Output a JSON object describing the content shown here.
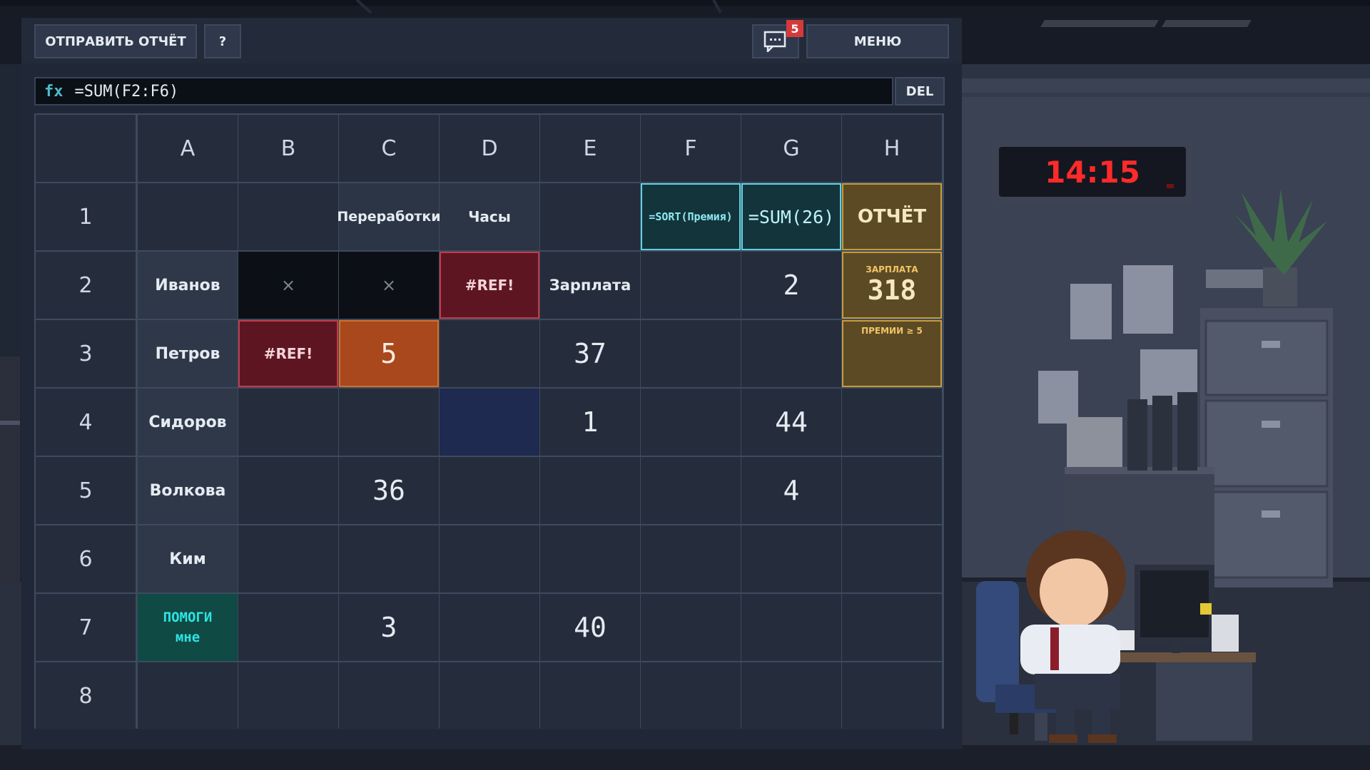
{
  "toolbar": {
    "send_report_label": "ОТПРАВИТЬ ОТЧЁТ",
    "help_label": "?",
    "messages_icon": "chat-icon",
    "messages_count": "5",
    "menu_label": "МЕНЮ"
  },
  "formula_bar": {
    "fx_label": "fx",
    "formula": "=SUM(F2:F6)",
    "del_label": "DEL"
  },
  "clock": {
    "time": "14:15"
  },
  "colors": {
    "accent_cyan": "#2fe3e3",
    "error_red": "#6b1622",
    "orange": "#c2571d",
    "gold": "#e0a93a",
    "clock_red": "#ff2a2a"
  },
  "sheet": {
    "columns": [
      "A",
      "B",
      "C",
      "D",
      "E",
      "F",
      "G",
      "H"
    ],
    "rows": [
      "1",
      "2",
      "3",
      "4",
      "5",
      "6",
      "7",
      "8"
    ],
    "cells": {
      "C1": "Переработки",
      "D1": "Часы",
      "F1": "=SORT(Премия)",
      "G1": "=SUM(26)",
      "H1": "ОТЧЁТ",
      "A2": "Иванов",
      "B2": "×",
      "C2": "×",
      "D2": "#REF!",
      "E2": "Зарплата",
      "G2": "2",
      "H2_label": "ЗАРПЛАТА",
      "H2": "318",
      "A3": "Петров",
      "B3": "#REF!",
      "C3": "5",
      "E3": "37",
      "H3_label": "ПРЕМИИ ≥ 5",
      "A4": "Сидоров",
      "E4": "1",
      "G4": "44",
      "A5": "Волкова",
      "C5": "36",
      "G5": "4",
      "A6": "Ким",
      "A7": "ПОМОГИ мне",
      "C7": "3",
      "E7": "40"
    }
  }
}
